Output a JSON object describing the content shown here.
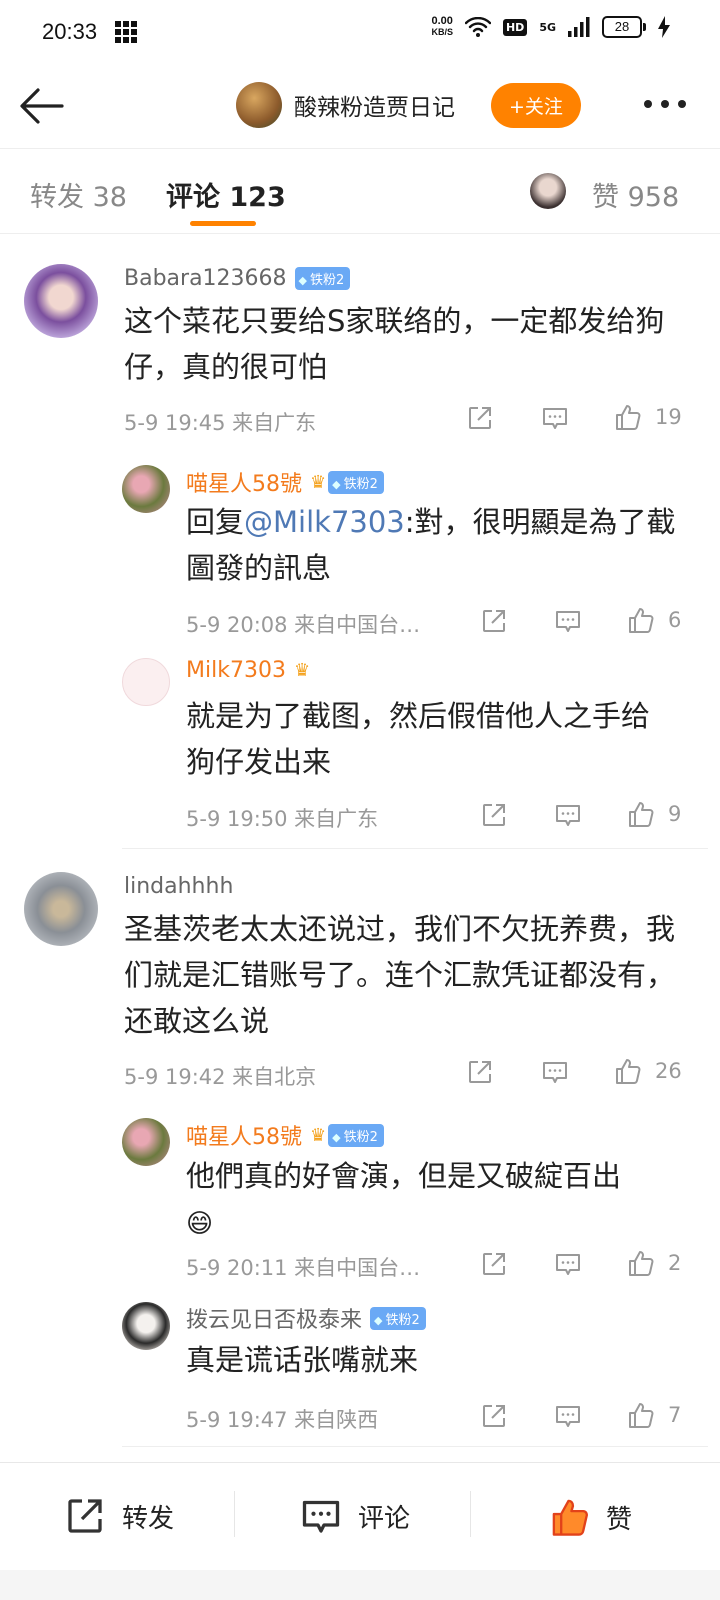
{
  "status": {
    "time": "20:33",
    "net_speed_value": "0.00",
    "net_speed_unit": "KB/S",
    "hd": "HD",
    "signal": "5G",
    "battery": "28"
  },
  "header": {
    "title": "酸辣粉造贾日记",
    "follow_label": "+关注"
  },
  "tabs": {
    "repost": "转发 38",
    "comment": "评论 123",
    "likes": "赞 958"
  },
  "comments": [
    {
      "user": "Babara123668",
      "badge": "铁粉2",
      "text": "这个菜花只要给S家联络的，一定都发给狗仔，真的很可怕",
      "meta": "5-9 19:45  来自广东",
      "likes": "19",
      "replies": [
        {
          "user": "喵星人58號",
          "badge": "铁粉2",
          "reply_prefix": "回复",
          "mention": "@Milk7303",
          "text": ":對，很明顯是為了截圖發的訊息",
          "meta": "5-9 20:08  来自中国台…",
          "likes": "6"
        },
        {
          "user": "Milk7303",
          "text": "就是为了截图，然后假借他人之手给狗仔发出来",
          "meta": "5-9 19:50  来自广东",
          "likes": "9"
        }
      ]
    },
    {
      "user": "lindahhhh",
      "text": "圣基茨老太太还说过，我们不欠抚养费，我们就是汇错账号了。连个汇款凭证都没有，还敢这么说",
      "meta": "5-9 19:42  来自北京",
      "likes": "26",
      "replies": [
        {
          "user": "喵星人58號",
          "badge": "铁粉2",
          "text": "他們真的好會演，但是又破綻百出",
          "emoji": "😄",
          "meta": "5-9 20:11  来自中国台…",
          "likes": "2"
        },
        {
          "user": "拨云见日否极泰来",
          "badge": "铁粉2",
          "text": "真是谎话张嘴就来",
          "meta": "5-9 19:47  来自陕西",
          "likes": "7"
        }
      ]
    }
  ],
  "bottom_bar": {
    "repost": "转发",
    "comment": "评论",
    "like": "赞"
  },
  "colors": {
    "accent": "#ff8200",
    "mention": "#4f79b5",
    "badge": "#6aa9f5",
    "orange_name": "#f37b1d"
  }
}
